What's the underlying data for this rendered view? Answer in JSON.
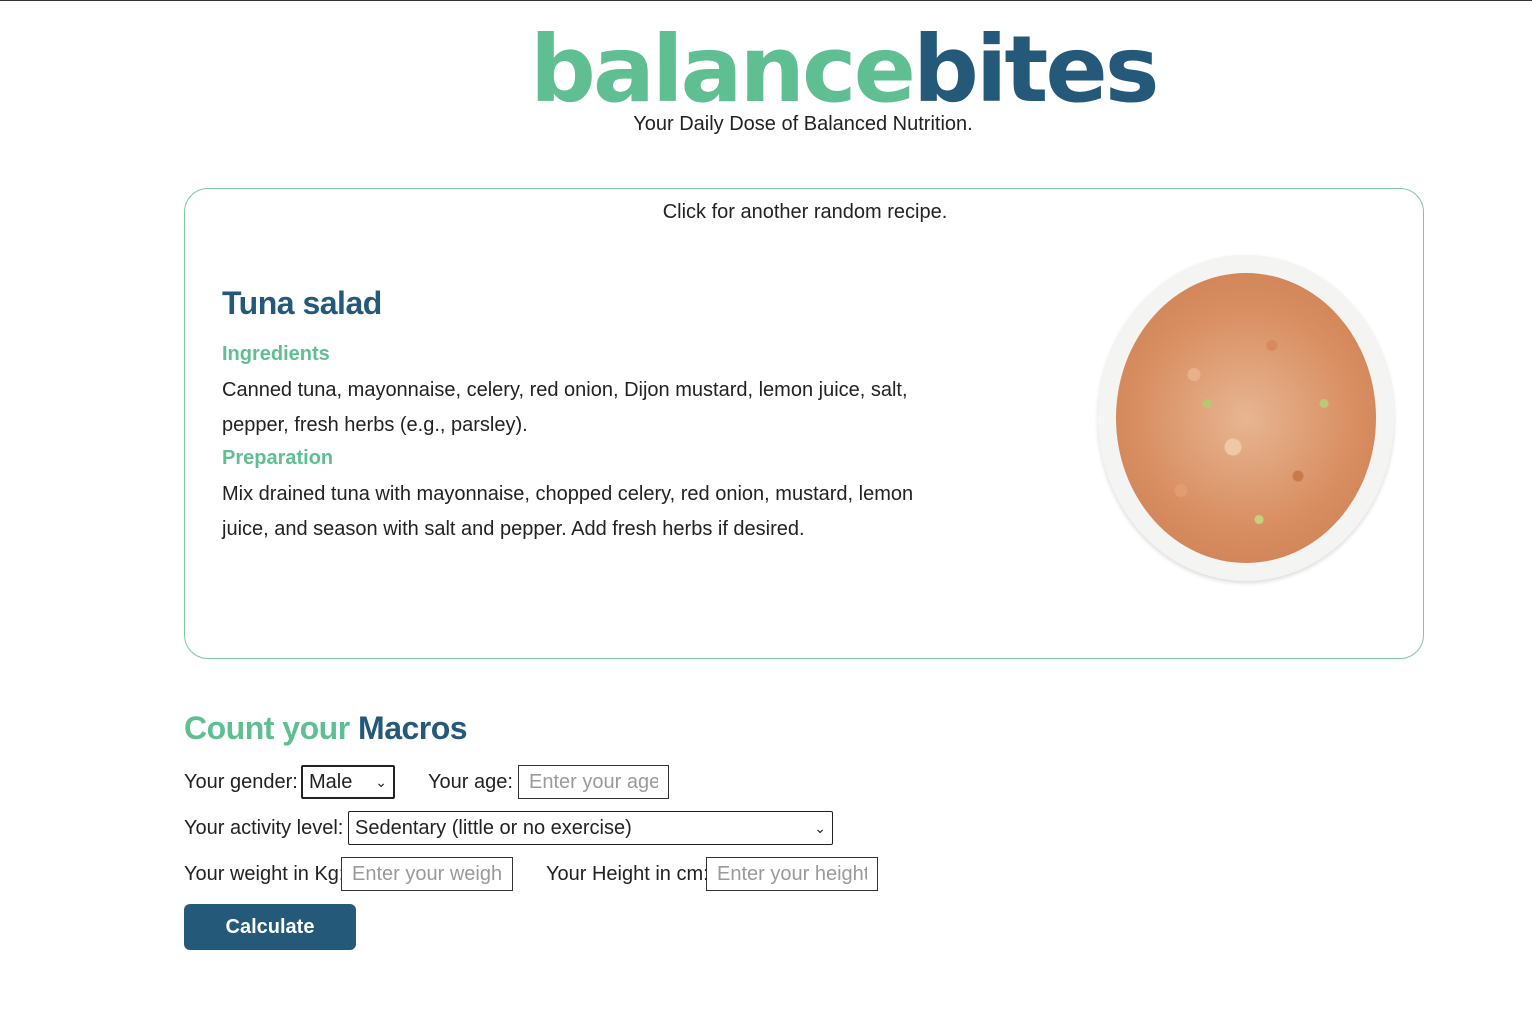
{
  "header": {
    "logo_part1": "balance",
    "logo_part2": "bites",
    "tagline": "Your Daily Dose of Balanced Nutrition."
  },
  "recipe": {
    "random_link": "Click for another random recipe.",
    "title": "Tuna salad",
    "ingredients_heading": "Ingredients",
    "ingredients_text": "Canned tuna, mayonnaise, celery, red onion, Dijon mustard, lemon juice, salt, pepper, fresh herbs (e.g., parsley).",
    "preparation_heading": "Preparation",
    "preparation_text": "Mix drained tuna with mayonnaise, chopped celery, red onion, mustard, lemon juice, and season with salt and pepper. Add fresh herbs if desired."
  },
  "macros": {
    "title_part1": "Count your",
    "title_part2": "Macros",
    "gender_label": "Your gender:",
    "gender_value": "Male",
    "age_label": "Your age:",
    "age_placeholder": "Enter your age",
    "activity_label": "Your activity level:",
    "activity_value": "Sedentary (little or no exercise)",
    "weight_label": "Your weight in Kg:",
    "weight_placeholder": "Enter your weight",
    "height_label": "Your Height in cm:",
    "height_placeholder": "Enter your height",
    "calculate_label": "Calculate"
  },
  "colors": {
    "accent_green": "#5fbf93",
    "brand_blue": "#24597a"
  }
}
